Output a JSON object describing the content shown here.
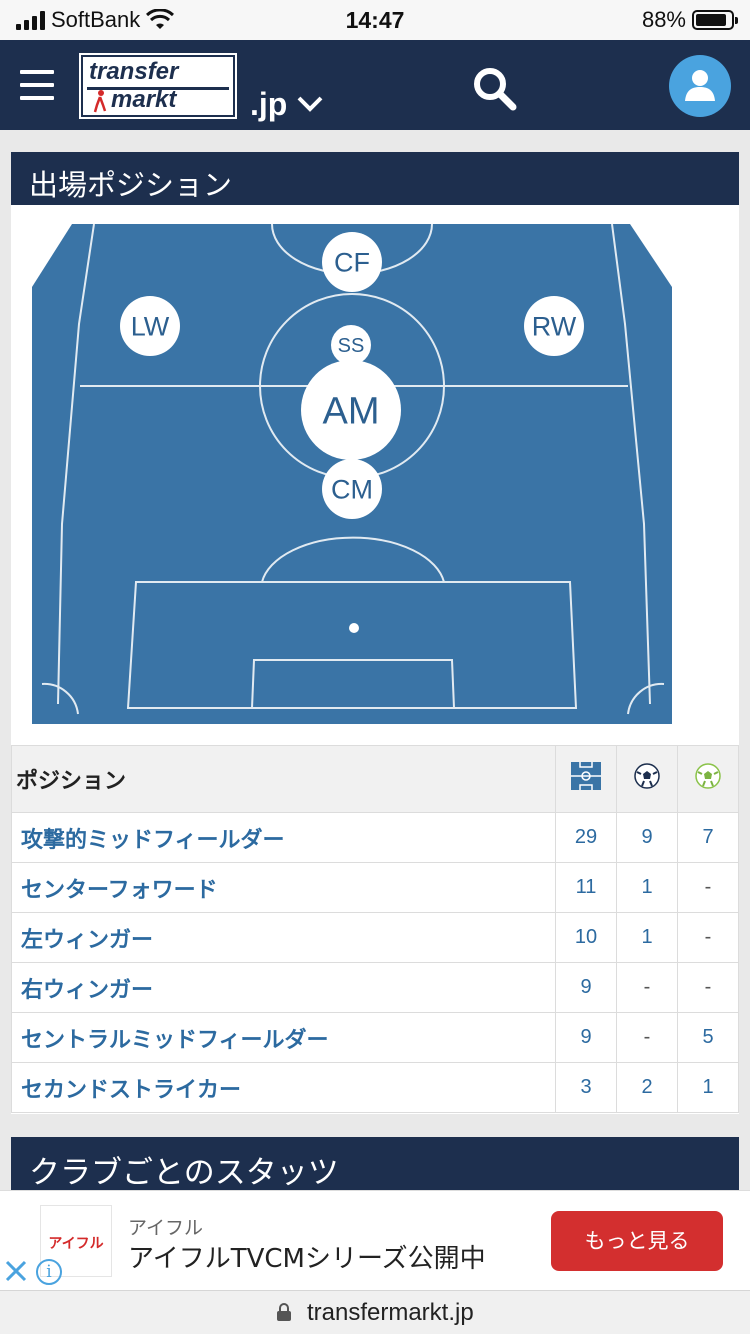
{
  "status_bar": {
    "carrier": "SoftBank",
    "time": "14:47",
    "battery": "88%",
    "battery_level": 0.88
  },
  "header": {
    "logo_line1": "transfer",
    "logo_line2": "markt",
    "domain": ".jp",
    "icons": [
      "menu-icon",
      "chevron-down-icon",
      "search-icon",
      "user-icon"
    ]
  },
  "positions_card": {
    "title": "出場ポジション",
    "pitch_markers": [
      {
        "code": "CF",
        "size": "m"
      },
      {
        "code": "LW",
        "size": "m"
      },
      {
        "code": "RW",
        "size": "m"
      },
      {
        "code": "SS",
        "size": "s"
      },
      {
        "code": "AM",
        "size": "l"
      },
      {
        "code": "CM",
        "size": "m"
      }
    ],
    "table": {
      "header": "ポジション",
      "column_icons": [
        "pitch-icon",
        "ball-icon",
        "ball-assist-icon"
      ],
      "rows": [
        {
          "name": "攻撃的ミッドフィールダー",
          "apps": "29",
          "goals": "9",
          "assists": "7"
        },
        {
          "name": "センターフォワード",
          "apps": "11",
          "goals": "1",
          "assists": "-"
        },
        {
          "name": "左ウィンガー",
          "apps": "10",
          "goals": "1",
          "assists": "-"
        },
        {
          "name": "右ウィンガー",
          "apps": "9",
          "goals": "-",
          "assists": "-"
        },
        {
          "name": "セントラルミッドフィールダー",
          "apps": "9",
          "goals": "-",
          "assists": "5"
        },
        {
          "name": "セカンドストライカー",
          "apps": "3",
          "goals": "2",
          "assists": "1"
        }
      ]
    }
  },
  "club_stats_card": {
    "title": "クラブごとのスタッツ"
  },
  "ad": {
    "logo_text": "アイフル",
    "sponsor": "アイフル",
    "text": "アイフルTVCMシリーズ公開中",
    "cta": "もっと見る"
  },
  "url_bar": {
    "url": "transfermarkt.jp"
  },
  "colors": {
    "navy": "#1d2f4e",
    "pitch": "#3a74a6",
    "link": "#2c6aa0",
    "cta": "#d32f2f"
  }
}
